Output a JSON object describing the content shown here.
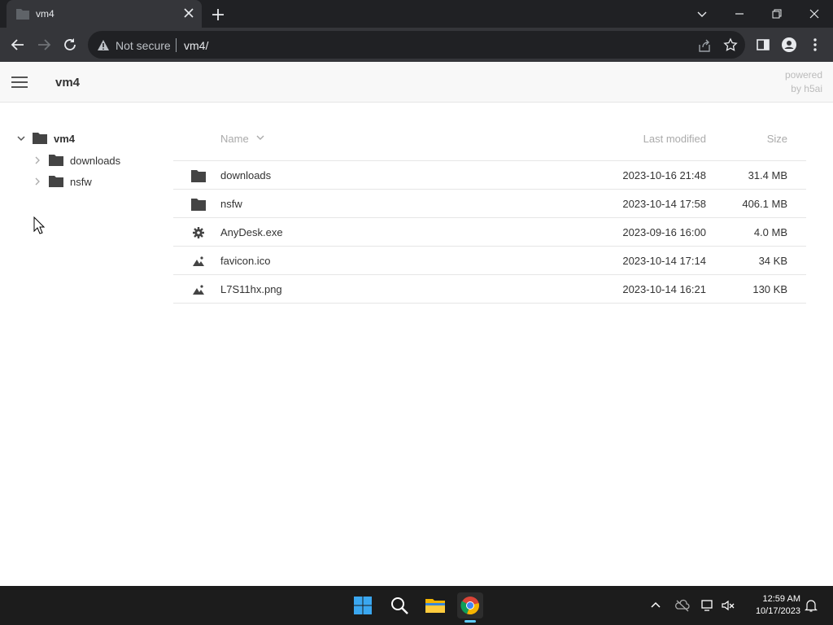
{
  "browser": {
    "tab_title": "vm4",
    "security_label": "Not secure",
    "url": "vm4/"
  },
  "header": {
    "breadcrumb": "vm4",
    "powered_line1": "powered",
    "powered_line2": "by h5ai"
  },
  "tree": {
    "root": "vm4",
    "children": [
      {
        "label": "downloads"
      },
      {
        "label": "nsfw"
      }
    ]
  },
  "listing": {
    "col_name": "Name",
    "col_modified": "Last modified",
    "col_size": "Size",
    "items": [
      {
        "name": "downloads",
        "modified": "2023-10-16 21:48",
        "size": "31.4 MB",
        "icon": "folder-icon"
      },
      {
        "name": "nsfw",
        "modified": "2023-10-14 17:58",
        "size": "406.1 MB",
        "icon": "folder-icon"
      },
      {
        "name": "AnyDesk.exe",
        "modified": "2023-09-16 16:00",
        "size": "4.0 MB",
        "icon": "gear-icon"
      },
      {
        "name": "favicon.ico",
        "modified": "2023-10-14 17:14",
        "size": "34 KB",
        "icon": "image-icon"
      },
      {
        "name": "L7S11hx.png",
        "modified": "2023-10-14 16:21",
        "size": "130 KB",
        "icon": "image-icon"
      }
    ]
  },
  "taskbar": {
    "time": "12:59 AM",
    "date": "10/17/2023"
  },
  "colors": {
    "chrome_dark": "#202124",
    "chrome_toolbar": "#35363a",
    "taskbar": "#1c1c1c",
    "accent": "#60cdff"
  }
}
